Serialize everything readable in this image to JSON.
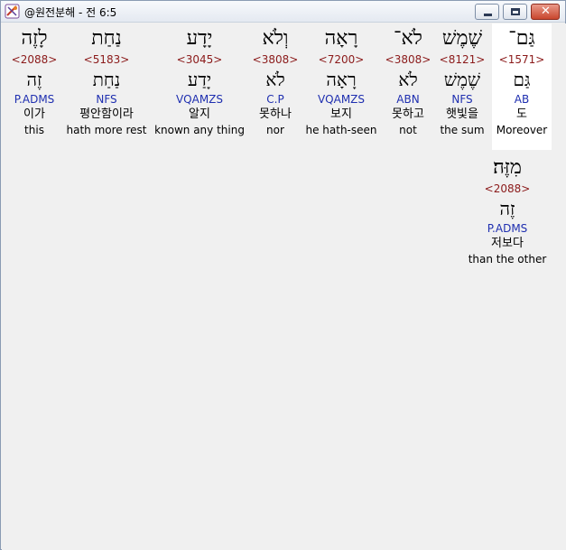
{
  "window": {
    "title": "@원전분해 - 전 6:5",
    "close_glyph": "✕"
  },
  "words": [
    {
      "hebrew": "גַּם־",
      "strongs": "<1571>",
      "lemma": "גַּם",
      "morph": "AB",
      "korean": "도",
      "english": "Moreover"
    },
    {
      "hebrew": "שֶׁמֶשׁ",
      "strongs": "<8121>",
      "lemma": "שֶׁמֶשׁ",
      "morph": "NFS",
      "korean": "햇빛을",
      "english": "the sum"
    },
    {
      "hebrew": "לֹא־",
      "strongs": "<3808>",
      "lemma": "לֹא",
      "morph": "ABN",
      "korean": "못하고",
      "english": "not"
    },
    {
      "hebrew": "רָאָה",
      "strongs": "<7200>",
      "lemma": "רָאָה",
      "morph": "VQAMZS",
      "korean": "보지",
      "english": "he hath-seen"
    },
    {
      "hebrew": "וְלֹא",
      "strongs": "<3808>",
      "lemma": "לֹא",
      "morph": "C.P",
      "korean": "못하나",
      "english": "nor"
    },
    {
      "hebrew": "יָדָע",
      "strongs": "<3045>",
      "lemma": "יָדַע",
      "morph": "VQAMZS",
      "korean": "알지",
      "english": "known any thing"
    },
    {
      "hebrew": "נַחַת",
      "strongs": "<5183>",
      "lemma": "נַחַת",
      "morph": "NFS",
      "korean": "평안함이라",
      "english": "hath more rest"
    },
    {
      "hebrew": "לָזֶה",
      "strongs": "<2088>",
      "lemma": "זֶה",
      "morph": "P.ADMS",
      "korean": "이가",
      "english": "this"
    },
    {
      "hebrew": "מִזֶּה׃",
      "strongs": "<2088>",
      "lemma": "זֶה",
      "morph": "P.ADMS",
      "korean": "저보다",
      "english": "than the other"
    }
  ]
}
